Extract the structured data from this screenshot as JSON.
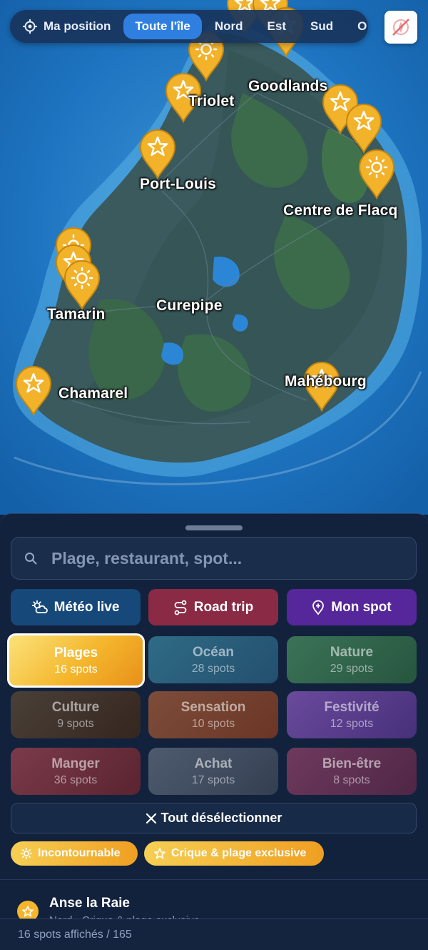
{
  "topbar": {
    "position_label": "Ma position",
    "tabs": [
      {
        "label": "Toute l'île",
        "active": true
      },
      {
        "label": "Nord",
        "active": false
      },
      {
        "label": "Est",
        "active": false
      },
      {
        "label": "Sud",
        "active": false
      },
      {
        "label": "O",
        "active": false
      }
    ]
  },
  "map": {
    "cities": [
      "Goodlands",
      "Triolet",
      "Port-Louis",
      "Centre de Flacq",
      "Tamarin",
      "Curepipe",
      "Chamarel",
      "Mahébourg"
    ],
    "pins": [
      {
        "icon": "sun-icon"
      },
      {
        "icon": "star-icon"
      },
      {
        "icon": "star-icon"
      },
      {
        "icon": "star-icon"
      },
      {
        "icon": "star-icon"
      },
      {
        "icon": "sun-icon"
      },
      {
        "icon": "sun-icon"
      },
      {
        "icon": "star-icon"
      },
      {
        "icon": "sun-icon"
      },
      {
        "icon": "star-icon"
      },
      {
        "icon": "star-icon"
      },
      {
        "icon": "star-icon"
      },
      {
        "icon": "star-icon"
      },
      {
        "icon": "star-icon"
      }
    ]
  },
  "search": {
    "placeholder": "Plage, restaurant, spot..."
  },
  "quick_actions": {
    "meteo": "Météo live",
    "road_trip": "Road trip",
    "mon_spot": "Mon spot"
  },
  "categories": [
    {
      "name": "Plages",
      "count": "16 spots",
      "selected": true,
      "color": "#f4b62c"
    },
    {
      "name": "Océan",
      "count": "28 spots",
      "selected": false,
      "color": "#2b6f86"
    },
    {
      "name": "Nature",
      "count": "29 spots",
      "selected": false,
      "color": "#2f6b4f"
    },
    {
      "name": "Culture",
      "count": "9 spots",
      "selected": false,
      "color": "#4b3a2e"
    },
    {
      "name": "Sensation",
      "count": "10 spots",
      "selected": false,
      "color": "#7a3f2e"
    },
    {
      "name": "Festivité",
      "count": "12 spots",
      "selected": false,
      "color": "#55358a"
    },
    {
      "name": "Manger",
      "count": "36 spots",
      "selected": false,
      "color": "#6e2b36"
    },
    {
      "name": "Achat",
      "count": "17 spots",
      "selected": false,
      "color": "#3c4c66"
    },
    {
      "name": "Bien-être",
      "count": "8 spots",
      "selected": false,
      "color": "#5e2f52"
    }
  ],
  "deselect_label": "Tout désélectionner",
  "chips": [
    "Incontournable",
    "Crique & plage exclusive"
  ],
  "list": [
    {
      "title": "Anse la Raie",
      "subtitle": "Nord · Crique & plage exclusive"
    }
  ],
  "footer": "16 spots affichés / 165"
}
